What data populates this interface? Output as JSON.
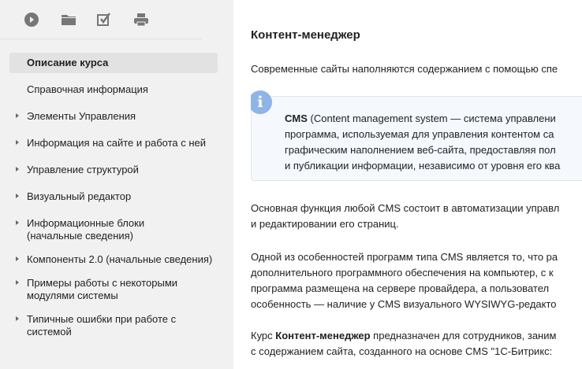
{
  "toolbar": {
    "icons": [
      "play-icon",
      "folder-icon",
      "checkbox-icon",
      "printer-icon"
    ]
  },
  "sidebar": {
    "items": [
      {
        "label": "Описание курса",
        "active": true,
        "arrow": false
      },
      {
        "label": "Справочная информация",
        "arrow": false
      },
      {
        "label": "Элементы Управления",
        "arrow": true
      },
      {
        "label": "Информация на сайте и работа с ней",
        "arrow": true
      },
      {
        "label": "Управление структурой",
        "arrow": true
      },
      {
        "label": "Визуальный редактор",
        "arrow": true
      },
      {
        "label": "Информационные блоки (начальные сведения)",
        "arrow": true
      },
      {
        "label": "Компоненты 2.0 (начальные сведения)",
        "arrow": true
      },
      {
        "label": "Примеры работы с некоторыми модулями системы",
        "arrow": true
      },
      {
        "label": "Типичные ошибки при работе с системой",
        "arrow": true
      }
    ]
  },
  "main": {
    "title": "Контент-менеджер",
    "intro": "Современные сайты наполняются содержанием с помощью спе",
    "info": {
      "bold": "CMS",
      "lines": [
        " (Content management system — система управлени",
        "программа, используемая для управления контентом са",
        "графическим наполнением веб-сайта, предоставляя пол",
        "и публикации информации, независимо от уровня его ква"
      ]
    },
    "p2": [
      "Основная функция любой CMS состоит в автоматизации управл",
      "и редактировании его страниц."
    ],
    "p3": [
      "Одной из особенностей программ типа CMS является то, что ра",
      "дополнительного программного обеспечения на компьютер, с к",
      "программа размещена на сервере провайдера, а пользовател",
      "особенность — наличие у CMS визуального WYSIWYG-редакто"
    ],
    "p4": {
      "pre": "Курс ",
      "bold": "Контент-менеджер",
      "post": " предназначен для сотрудников, заним",
      "line2": "с содержанием сайта, созданного на основе CMS \"1С-Битрикс:"
    }
  }
}
